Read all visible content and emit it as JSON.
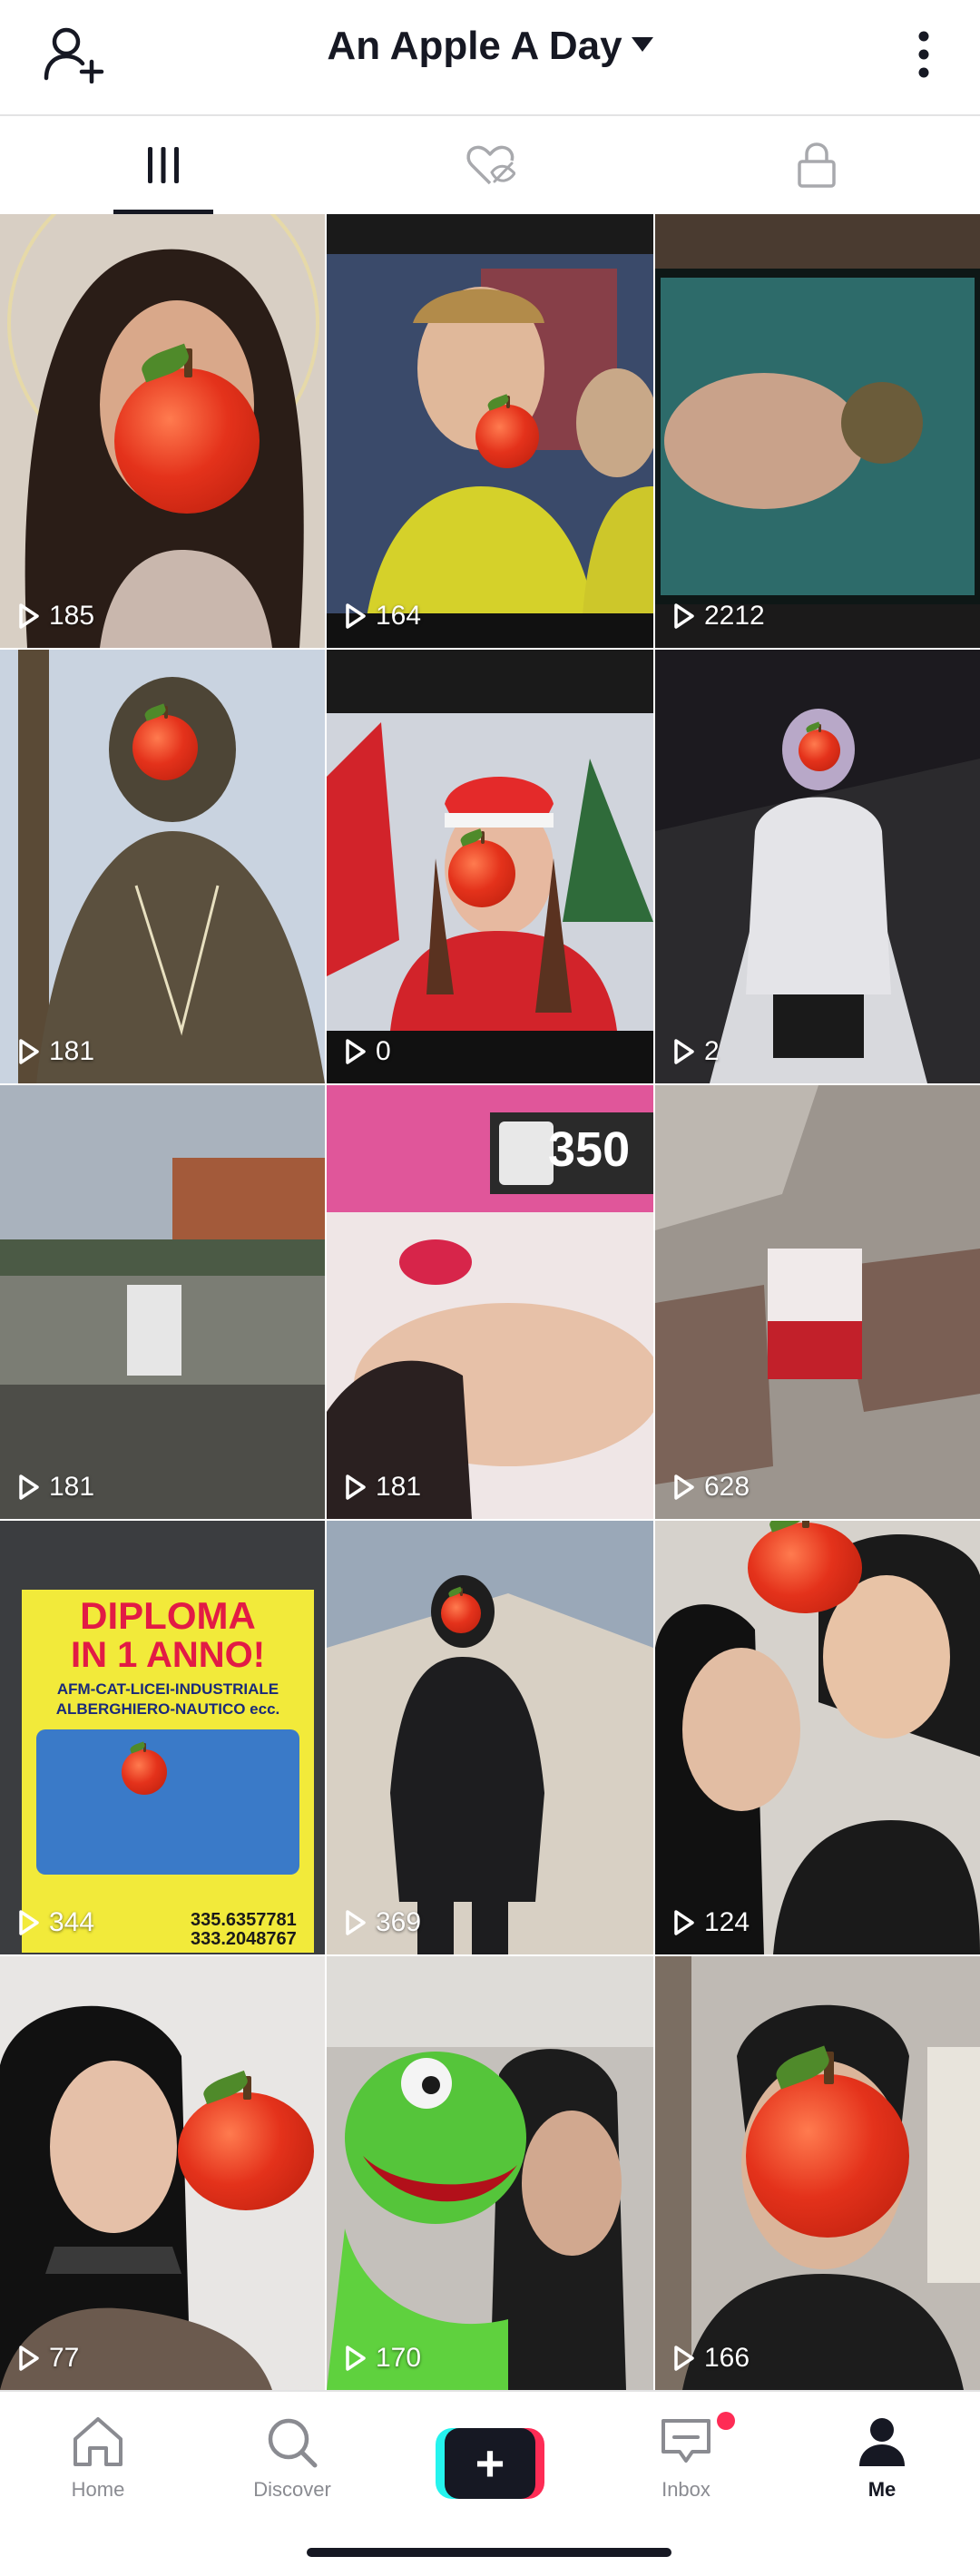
{
  "header": {
    "title": "An Apple A Day",
    "left_icon": "add-friend-icon",
    "right_icon": "more-options-icon"
  },
  "tabs": [
    {
      "icon": "videos-grid-icon",
      "active": true
    },
    {
      "icon": "liked-hidden-icon",
      "active": false
    },
    {
      "icon": "private-lock-icon",
      "active": false
    }
  ],
  "videos": [
    {
      "views": "185"
    },
    {
      "views": "164"
    },
    {
      "views": "2212"
    },
    {
      "views": "181"
    },
    {
      "views": "0"
    },
    {
      "views": "2"
    },
    {
      "views": "181"
    },
    {
      "views": "181"
    },
    {
      "views": "628"
    },
    {
      "views": "344"
    },
    {
      "views": "369"
    },
    {
      "views": "124"
    },
    {
      "views": "77"
    },
    {
      "views": "170"
    },
    {
      "views": "166"
    }
  ],
  "thumb_text": {
    "phone_sign": "350",
    "diploma_line1": "DIPLOMA",
    "diploma_line2": "IN 1 ANNO!",
    "diploma_line3": "AFM-CAT-LICEI-INDUSTRIALE",
    "diploma_line4": "ALBERGHIERO-NAUTICO ecc.",
    "diploma_phone1": "335.6357781",
    "diploma_phone2": "333.2048767"
  },
  "bottom_nav": {
    "home": "Home",
    "discover": "Discover",
    "inbox": "Inbox",
    "me": "Me"
  },
  "colors": {
    "accent_red": "#fe2c55",
    "accent_cyan": "#25f4ee",
    "text_dark": "#161823",
    "text_muted": "#8a8b91"
  }
}
